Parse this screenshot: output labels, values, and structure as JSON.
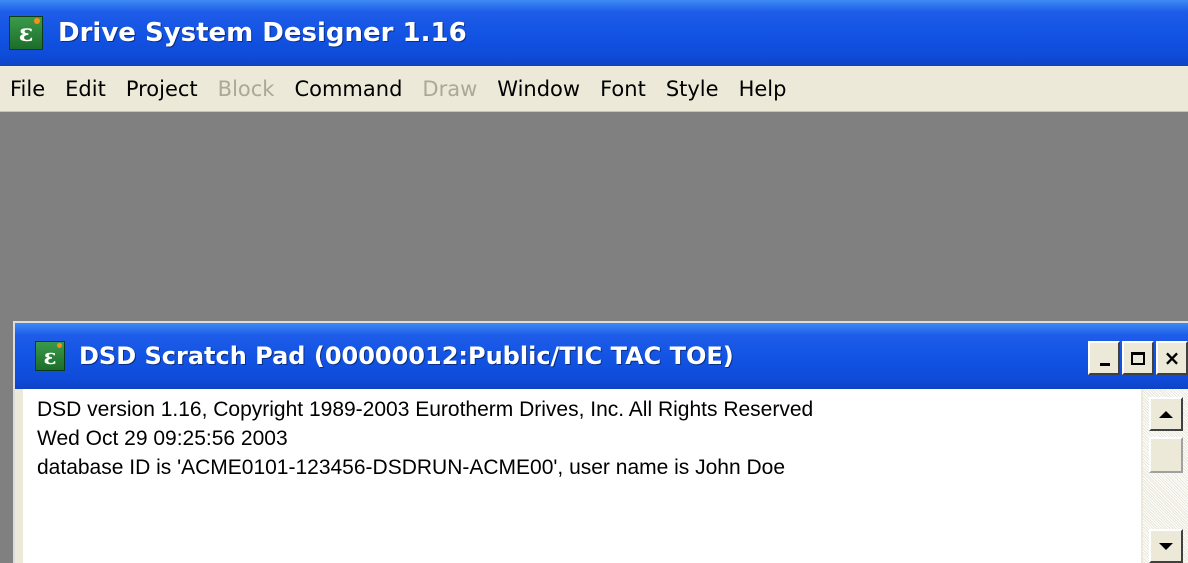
{
  "app": {
    "title": "Drive System Designer 1.16",
    "icon": "app-epsilon-icon"
  },
  "menubar": {
    "items": [
      {
        "label": "File",
        "enabled": true
      },
      {
        "label": "Edit",
        "enabled": true
      },
      {
        "label": "Project",
        "enabled": true
      },
      {
        "label": "Block",
        "enabled": false
      },
      {
        "label": "Command",
        "enabled": true
      },
      {
        "label": "Draw",
        "enabled": false
      },
      {
        "label": "Window",
        "enabled": true
      },
      {
        "label": "Font",
        "enabled": true
      },
      {
        "label": "Style",
        "enabled": true
      },
      {
        "label": "Help",
        "enabled": true
      }
    ]
  },
  "scratch_pad": {
    "title": "DSD Scratch Pad (00000012:Public/TIC TAC TOE)",
    "icon": "app-epsilon-icon",
    "controls": {
      "minimize": "minimize-icon",
      "maximize": "maximize-icon",
      "close": "close-icon",
      "close_label": "×"
    },
    "lines": [
      "DSD version 1.16, Copyright 1989-2003 Eurotherm Drives, Inc.  All Rights Reserved",
      "Wed Oct 29 09:25:56 2003",
      "database ID is 'ACME0101-123456-DSDRUN-ACME00', user name is John Doe"
    ]
  },
  "icon_glyph": "ε",
  "colors": {
    "titlebar": "#1253e3",
    "menubar": "#ece9d8",
    "workspace": "#808080",
    "disabled_text": "#aca899"
  }
}
